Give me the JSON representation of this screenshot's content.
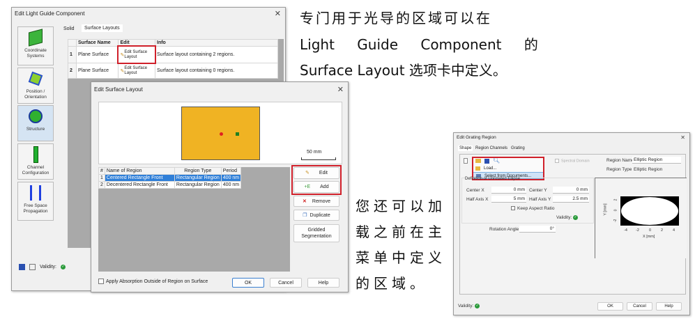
{
  "light_guide_dialog": {
    "title": "Edit Light Guide Component",
    "tabs": [
      {
        "label": "Solid"
      },
      {
        "label": "Surface Layouts",
        "active": true
      }
    ],
    "sidebar": [
      {
        "label": "Coordinate Systems"
      },
      {
        "label": "Position / Orientation"
      },
      {
        "label": "Structure",
        "active": true
      },
      {
        "label": "Channel Configuration"
      },
      {
        "label": "Free Space Propagation"
      }
    ],
    "table": {
      "headers": [
        "",
        "Surface Name",
        "Edit",
        "Info"
      ],
      "rows": [
        {
          "num": "1",
          "name": "Plane Surface",
          "edit": "Edit Surface Layout",
          "info": "Surface layout containing 2 regions."
        },
        {
          "num": "2",
          "name": "Plane Surface",
          "edit": "Edit Surface Layout",
          "info": "Surface layout containing 0 regions."
        }
      ]
    },
    "validity_label": "Validity:"
  },
  "surface_layout_dialog": {
    "title": "Edit Surface Layout",
    "scale_bar": "50 mm",
    "table": {
      "headers": [
        "#",
        "Name of Region",
        "Region Type",
        "Period"
      ],
      "rows": [
        {
          "num": "1",
          "name": "Centered Rectangle Front",
          "type": "Rectangular Region",
          "period": "400 nm",
          "selected": true
        },
        {
          "num": "2",
          "name": "Decentered Rectangle Front",
          "type": "Rectangular Region",
          "period": "400 nm"
        }
      ]
    },
    "buttons": {
      "edit": "Edit",
      "add": "Add",
      "remove": "Remove",
      "duplicate": "Duplicate",
      "gridded": "Gridded Segmentation"
    },
    "apply_absorption": "Apply Absorption Outside of Region on Surface",
    "ok": "OK",
    "cancel": "Cancel",
    "help": "Help"
  },
  "grating_dialog": {
    "title": "Edit Grating Region",
    "tabs": [
      {
        "label": "Shape",
        "active": true
      },
      {
        "label": "Region Channels"
      },
      {
        "label": "Grating"
      }
    ],
    "menu": {
      "load": "Load...",
      "select": "Select from Documents..."
    },
    "spectral_domain": "Spectral Domain",
    "region_name_label": "Region Name",
    "region_name": "Elliptic Region",
    "region_type_label": "Region Type",
    "region_type": "Elliptic Region",
    "group_title": "Definition of Unrotated Ellipse",
    "center_x_label": "Center X",
    "center_x": "0 mm",
    "center_y_label": "Center Y",
    "center_y": "0 mm",
    "half_x_label": "Half Axis X",
    "half_x": "5 mm",
    "half_y_label": "Half Axis Y",
    "half_y": "2.5 mm",
    "keep_aspect": "Keep Aspect Ratio",
    "validity_label": "Validity:",
    "rotation_label": "Rotation Angle",
    "rotation": "0°",
    "plot": {
      "xlabel": "X [mm]",
      "ylabel": "Y [mm]",
      "xticks": [
        "-4",
        "-2",
        "0",
        "2",
        "4"
      ],
      "yticks": [
        "2",
        "0",
        "-2"
      ]
    },
    "ok": "OK",
    "cancel": "Cancel",
    "help": "Help"
  },
  "annotations": {
    "top": [
      "专门用于光导的区域可以在",
      "Light Guide Component 的",
      "Surface Layout 选项卡中定义。"
    ],
    "middle": [
      "您还可以加",
      "载之前在主",
      "菜单中定义",
      "的区域。"
    ]
  },
  "colors": {
    "highlight": "#d0202a",
    "selection": "#2f7fd8",
    "preview_fill": "#f0b323",
    "valid": "#2a9a3a"
  }
}
